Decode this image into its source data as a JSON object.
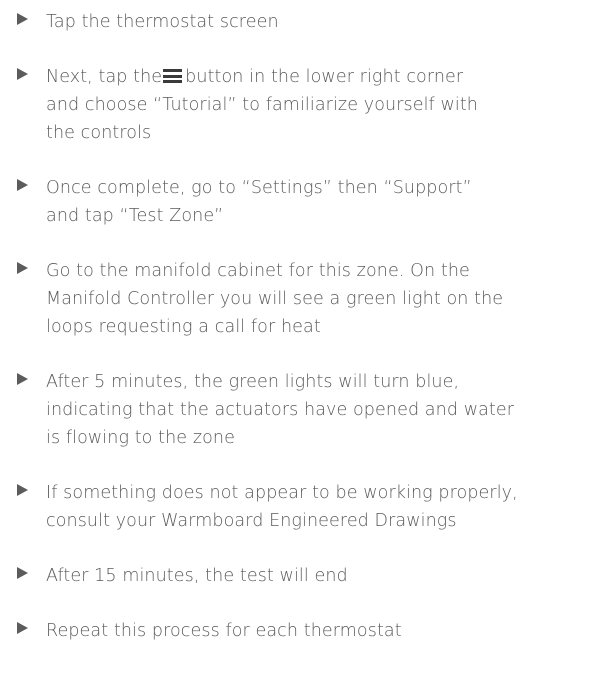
{
  "steps": [
    {
      "lines": [
        "Tap the thermostat screen"
      ]
    },
    {
      "line1_before_icon": "Next, tap the",
      "line1_after_icon": "button in the lower right corner",
      "icon": "menu-icon",
      "lines": [
        "and choose “Tutorial” to familiarize yourself with",
        "the controls"
      ]
    },
    {
      "lines": [
        "Once complete, go to “Settings” then “Support”",
        "and tap “Test Zone”"
      ]
    },
    {
      "lines": [
        "Go to the manifold cabinet for this zone. On the",
        "Manifold Controller you will see a green light on the",
        "loops requesting a call for heat"
      ]
    },
    {
      "lines": [
        "After 5 minutes, the green lights will turn blue,",
        "indicating that the actuators have opened and water",
        "is flowing to the zone"
      ]
    },
    {
      "lines": [
        "If something does not appear to be working properly,",
        "consult your Warmboard Engineered Drawings"
      ]
    },
    {
      "lines": [
        "After 15 minutes, the test will end"
      ]
    },
    {
      "lines": [
        "Repeat this process for each thermostat"
      ]
    }
  ],
  "colors": {
    "text": "#5a5a5a",
    "bullet": "#5c5c5c",
    "icon": "#3a3a3a",
    "background": "#ffffff"
  }
}
